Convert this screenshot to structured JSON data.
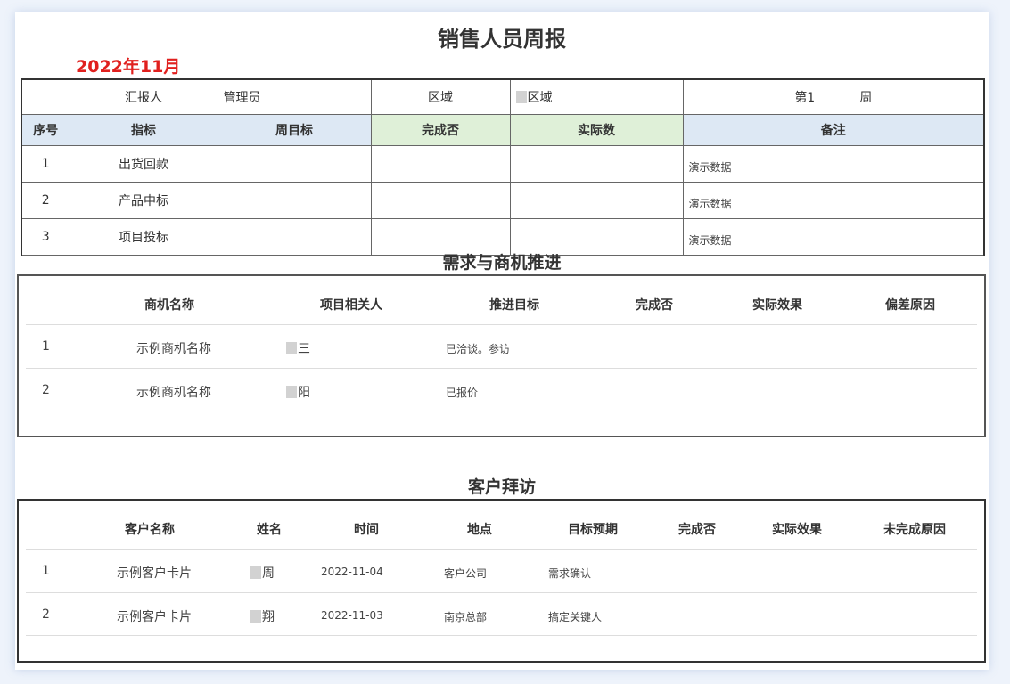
{
  "report": {
    "title": "销售人员周报",
    "month": "2022年11月"
  },
  "weekly": {
    "reporter_label": "汇报人",
    "reporter_value": "管理员",
    "region_label": "区域",
    "region_value": "区域",
    "week_prefix": "第1",
    "week_suffix": "周",
    "headers": [
      "序号",
      "指标",
      "周目标",
      "完成否",
      "实际数",
      "备注"
    ],
    "rows": [
      {
        "no": "1",
        "metric": "出货回款",
        "target": "",
        "done": "",
        "actual": "",
        "note": "演示数据"
      },
      {
        "no": "2",
        "metric": "产品中标",
        "target": "",
        "done": "",
        "actual": "",
        "note": "演示数据"
      },
      {
        "no": "3",
        "metric": "项目投标",
        "target": "",
        "done": "",
        "actual": "",
        "note": "演示数据"
      }
    ]
  },
  "opportunities": {
    "title": "需求与商机推进",
    "headers": [
      "商机名称",
      "项目相关人",
      "推进目标",
      "完成否",
      "实际效果",
      "偏差原因"
    ],
    "rows": [
      {
        "no": "1",
        "name": "示例商机名称",
        "person": "三",
        "goal": "已洽谈。参访",
        "done": "",
        "effect": "",
        "reason": ""
      },
      {
        "no": "2",
        "name": "示例商机名称",
        "person": "阳",
        "goal": "已报价",
        "done": "",
        "effect": "",
        "reason": ""
      }
    ]
  },
  "visits": {
    "title": "客户拜访",
    "headers": [
      "客户名称",
      "姓名",
      "时间",
      "地点",
      "目标预期",
      "完成否",
      "实际效果",
      "未完成原因"
    ],
    "rows": [
      {
        "no": "1",
        "customer": "示例客户卡片",
        "name": "周",
        "time": "2022-11-04",
        "place": "客户公司",
        "goal": "需求确认",
        "done": "",
        "effect": "",
        "reason": ""
      },
      {
        "no": "2",
        "customer": "示例客户卡片",
        "name": "翔",
        "time": "2022-11-03",
        "place": "南京总部",
        "goal": "搞定关键人",
        "done": "",
        "effect": "",
        "reason": ""
      }
    ]
  },
  "colors": {
    "month_red": "#e0201e",
    "header_blue": "#dde8f4",
    "header_green": "#dff0d8"
  }
}
